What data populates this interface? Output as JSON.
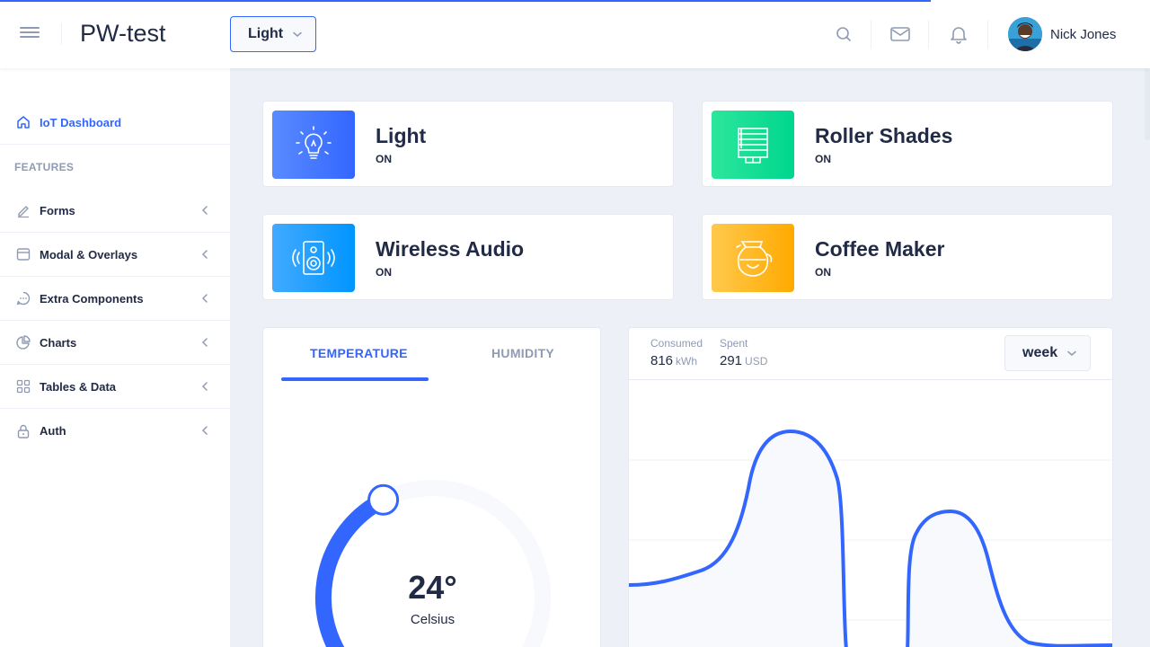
{
  "header": {
    "logo": "PW-test",
    "theme_select": "Light",
    "user_name": "Nick Jones"
  },
  "sidebar": {
    "items": [
      {
        "label": "IoT Dashboard",
        "icon": "home-icon",
        "active": true
      },
      {
        "group": "FEATURES"
      },
      {
        "label": "Forms",
        "icon": "edit-icon"
      },
      {
        "label": "Modal & Overlays",
        "icon": "browser-icon"
      },
      {
        "label": "Extra Components",
        "icon": "message-circle-icon"
      },
      {
        "label": "Charts",
        "icon": "pie-chart-icon"
      },
      {
        "label": "Tables & Data",
        "icon": "grid-icon"
      },
      {
        "label": "Auth",
        "icon": "lock-icon"
      }
    ]
  },
  "status_cards": [
    {
      "title": "Light",
      "status": "ON",
      "icon": "lightbulb-icon",
      "color": "#3366ff"
    },
    {
      "title": "Roller Shades",
      "status": "ON",
      "icon": "roller-shades-icon",
      "color": "#00d68f"
    },
    {
      "title": "Wireless Audio",
      "status": "ON",
      "icon": "audio-speaker-icon",
      "color": "#0095ff"
    },
    {
      "title": "Coffee Maker",
      "status": "ON",
      "icon": "coffee-maker-icon",
      "color": "#ffaa00"
    }
  ],
  "temperature": {
    "tabs": [
      "TEMPERATURE",
      "HUMIDITY"
    ],
    "value": "24°",
    "unit": "Celsius",
    "level": 0.4
  },
  "electricity": {
    "consumed_label": "Consumed",
    "consumed_value": "816",
    "consumed_unit": "kWh",
    "spent_label": "Spent",
    "spent_value": "291",
    "spent_unit": "USD",
    "period": "week"
  },
  "colors": {
    "primary": "#3366ff",
    "success": "#00d68f",
    "info": "#0095ff",
    "warning": "#ffaa00"
  }
}
